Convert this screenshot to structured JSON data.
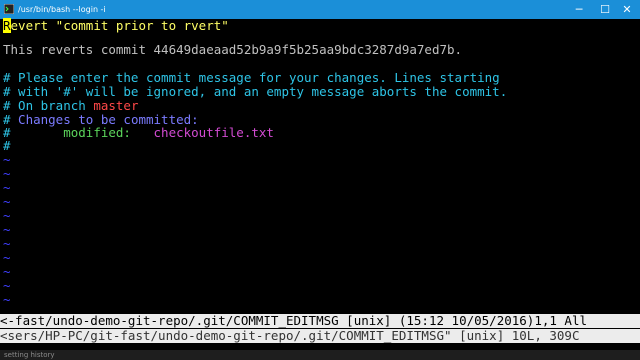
{
  "window": {
    "title": "/usr/bin/bash --login -i",
    "minimize_glyph": "─",
    "maximize_glyph": "☐",
    "close_glyph": "✕"
  },
  "editor": {
    "line1_prefix": "R",
    "line1_rest": "evert \"commit prior to rvert\"",
    "line2": "",
    "line3": "This reverts commit 44649daeaad52b9a9f5b25aa9bdc3287d9a7ed7b.",
    "line4": "",
    "line5": "# Please enter the commit message for your changes. Lines starting",
    "line6": "# with '#' will be ignored, and an empty message aborts the commit.",
    "line7_prefix": "# On branch ",
    "line7_branch": "master",
    "line8_hash": "#",
    "line8_text": " Changes to be committed:",
    "line9_hash": "#",
    "line9_label": "       modified:",
    "line9_file": "   checkoutfile.txt",
    "line10": "#",
    "tilde": "~"
  },
  "status_active": "<-fast/undo-demo-git-repo/.git/COMMIT_EDITMSG [unix] (15:12 10/05/2016)1,1 All",
  "status_inactive": "<sers/HP-PC/git-fast/undo-demo-git-repo/.git/COMMIT_EDITMSG\" [unix] 10L, 309C",
  "footer_ghost": "setting history"
}
